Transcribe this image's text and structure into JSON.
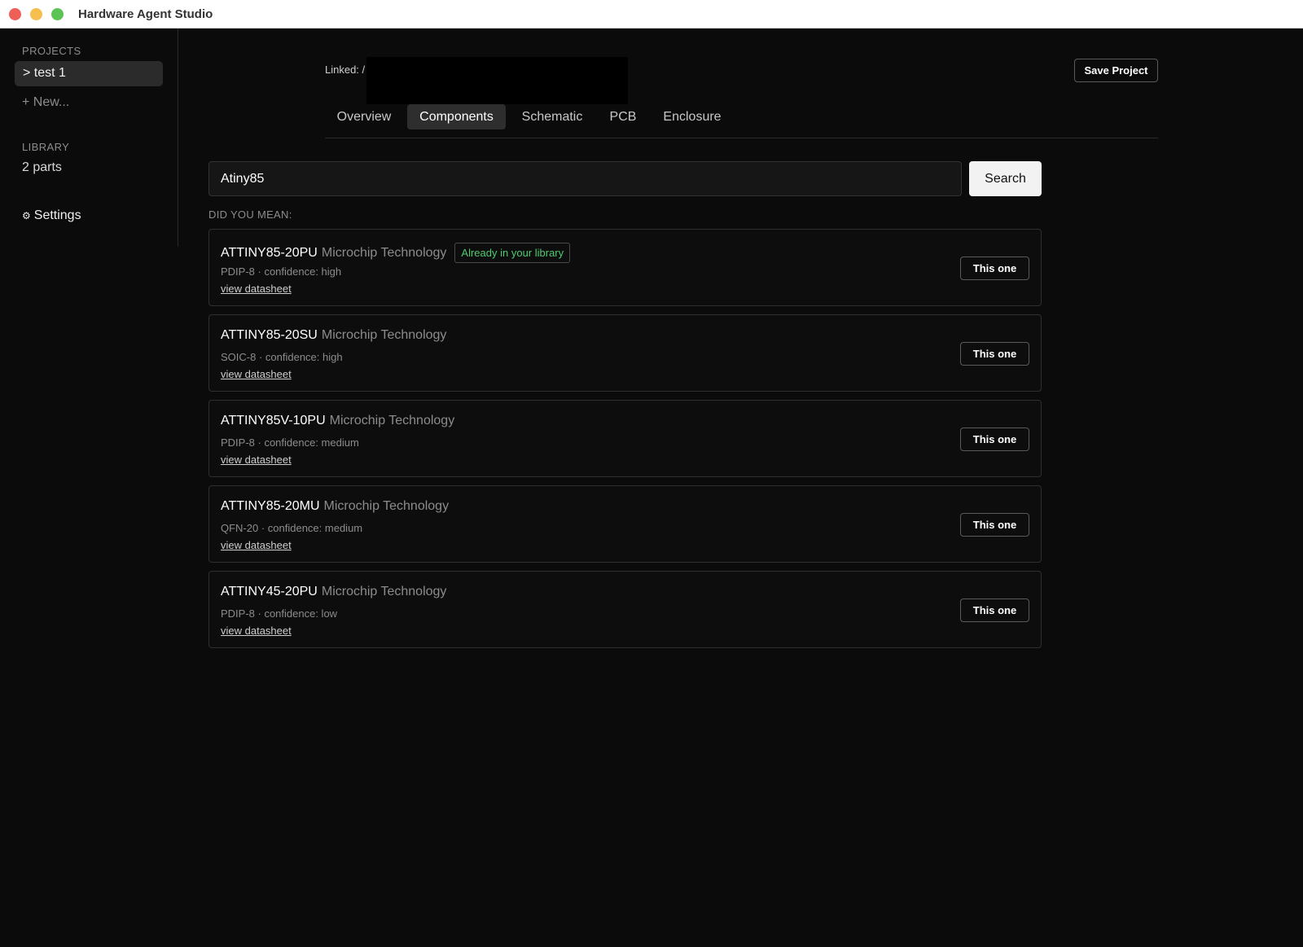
{
  "window": {
    "title": "Hardware Agent Studio"
  },
  "sidebar": {
    "projects_heading": "PROJECTS",
    "active_project": "> test 1",
    "new_label": "+ New...",
    "library_heading": "LIBRARY",
    "library_count": "2 parts",
    "settings_icon": "⚙",
    "settings_label": "Settings"
  },
  "header": {
    "linked_label": "Linked: /",
    "save_label": "Save Project"
  },
  "tabs": [
    {
      "label": "Overview"
    },
    {
      "label": "Components",
      "active": true
    },
    {
      "label": "Schematic"
    },
    {
      "label": "PCB"
    },
    {
      "label": "Enclosure"
    }
  ],
  "search": {
    "value": "Atiny85",
    "button_label": "Search"
  },
  "suggestions_heading": "DID YOU MEAN:",
  "results": [
    {
      "part": "ATTINY85-20PU",
      "maker": "Microchip Technology",
      "badge": "Already in your library",
      "meta": "PDIP-8 · confidence: high",
      "link": "view datasheet",
      "action": "This one"
    },
    {
      "part": "ATTINY85-20SU",
      "maker": "Microchip Technology",
      "meta": "SOIC-8 · confidence: high",
      "link": "view datasheet",
      "action": "This one"
    },
    {
      "part": "ATTINY85V-10PU",
      "maker": "Microchip Technology",
      "meta": "PDIP-8 · confidence: medium",
      "link": "view datasheet",
      "action": "This one"
    },
    {
      "part": "ATTINY85-20MU",
      "maker": "Microchip Technology",
      "meta": "QFN-20 · confidence: medium",
      "link": "view datasheet",
      "action": "This one"
    },
    {
      "part": "ATTINY45-20PU",
      "maker": "Microchip Technology",
      "meta": "PDIP-8 · confidence: low",
      "link": "view datasheet",
      "action": "This one"
    }
  ],
  "colors": {
    "background": "#0b0b0b",
    "badge_green": "#4ecb71",
    "active_tab": "#2e2e2e"
  }
}
